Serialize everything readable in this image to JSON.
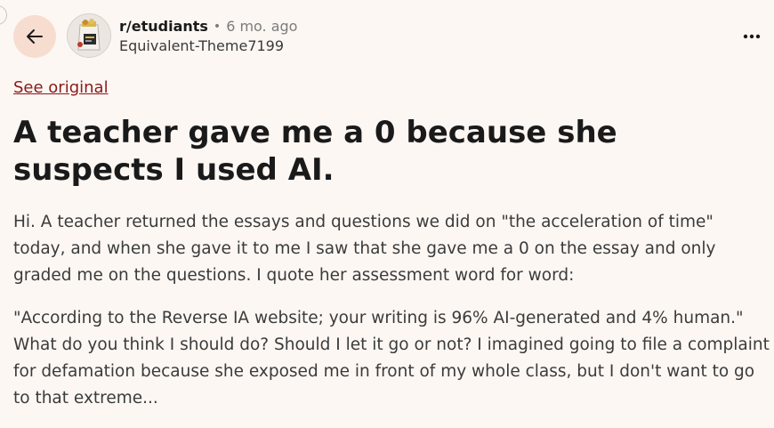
{
  "header": {
    "subreddit": "r/etudiants",
    "separator": "•",
    "time": "6 mo. ago",
    "author": "Equivalent-Theme7199"
  },
  "icons": {
    "back": "arrow-left-icon",
    "more": "ellipsis-icon"
  },
  "see_original": "See original",
  "post": {
    "title": "A teacher gave me a 0 because she suspects I used AI.",
    "paragraphs": [
      "Hi. A teacher returned the essays and questions we did on \"the acceleration of time\" today, and when she gave it to me I saw that she gave me a 0 on the essay and only graded me on the questions. I quote her assessment word for word:",
      "\"According to the Reverse IA website; your writing is 96% AI-generated and 4% human.\" What do you think I should do? Should I let it go or not? I imagined going to file a complaint for defamation because she exposed me in front of my whole class, but I don't want to go to that extreme..."
    ]
  },
  "colors": {
    "background": "#fdf7f3",
    "back_button_bg": "#f7ddd0",
    "link": "#8b1a1a"
  }
}
